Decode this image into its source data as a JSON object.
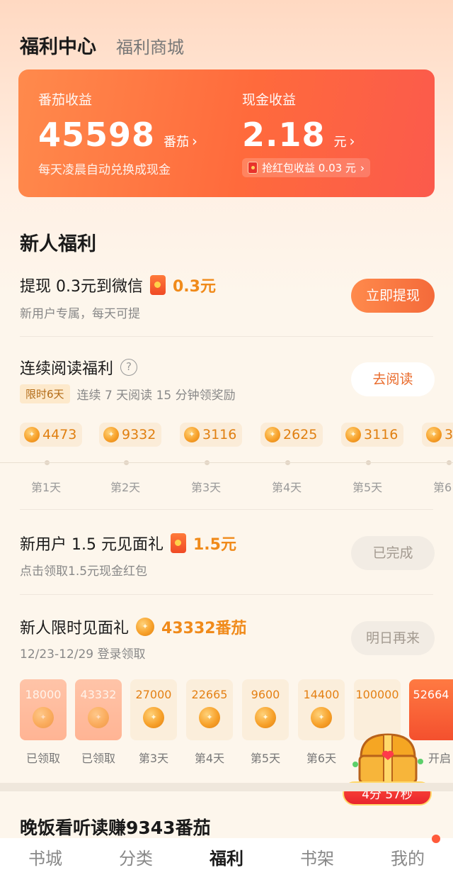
{
  "header": {
    "tab_active": "福利中心",
    "tab_inactive": "福利商城"
  },
  "earnings": {
    "tomato_label": "番茄收益",
    "tomato_value": "45598",
    "tomato_unit": "番茄",
    "tomato_sub": "每天凌晨自动兑换成现金",
    "cash_label": "现金收益",
    "cash_value": "2.18",
    "cash_unit": "元",
    "redpacket_income": "抢红包收益 0.03 元"
  },
  "newbie": {
    "title": "新人福利",
    "withdraw": {
      "title": "提现 0.3元到微信",
      "amount": "0.3元",
      "sub": "新用户专属，每天可提",
      "button": "立即提现"
    },
    "reading": {
      "title": "连续阅读福利",
      "help": "?",
      "tag": "限时6天",
      "sub": "连续 7 天阅读 15 分钟领奖励",
      "button": "去阅读",
      "rewards": [
        {
          "value": "4473",
          "day": "第1天"
        },
        {
          "value": "9332",
          "day": "第2天"
        },
        {
          "value": "3116",
          "day": "第3天"
        },
        {
          "value": "2625",
          "day": "第4天"
        },
        {
          "value": "3116",
          "day": "第5天"
        },
        {
          "value": "3",
          "day": "第6"
        }
      ]
    },
    "gift15": {
      "title": "新用户 1.5 元见面礼",
      "amount": "1.5元",
      "sub": "点击领取1.5元现金红包",
      "button": "已完成"
    },
    "limited": {
      "title": "新人限时见面礼",
      "amount": "43332番茄",
      "sub": "12/23-12/29 登录领取",
      "button": "明日再来",
      "cards": [
        {
          "value": "18000",
          "day": "已领取",
          "claimed": true
        },
        {
          "value": "43332",
          "day": "已领取",
          "claimed": true
        },
        {
          "value": "27000",
          "day": "第3天"
        },
        {
          "value": "22665",
          "day": "第4天"
        },
        {
          "value": "9600",
          "day": "第5天"
        },
        {
          "value": "14400",
          "day": "第6天"
        },
        {
          "value": "100000",
          "day": ""
        },
        {
          "value": "52664",
          "day": "开启"
        }
      ],
      "timer": "4分 57秒"
    }
  },
  "dinner": {
    "title": "晚饭看听读赚9343番茄"
  },
  "nav": {
    "items": [
      "书城",
      "分类",
      "福利",
      "书架",
      "我的"
    ],
    "active_index": 2
  },
  "colors": {
    "accent": "#f08a1a",
    "card_orange": "#ff6a3c",
    "button_orange": "#f46a3a"
  }
}
